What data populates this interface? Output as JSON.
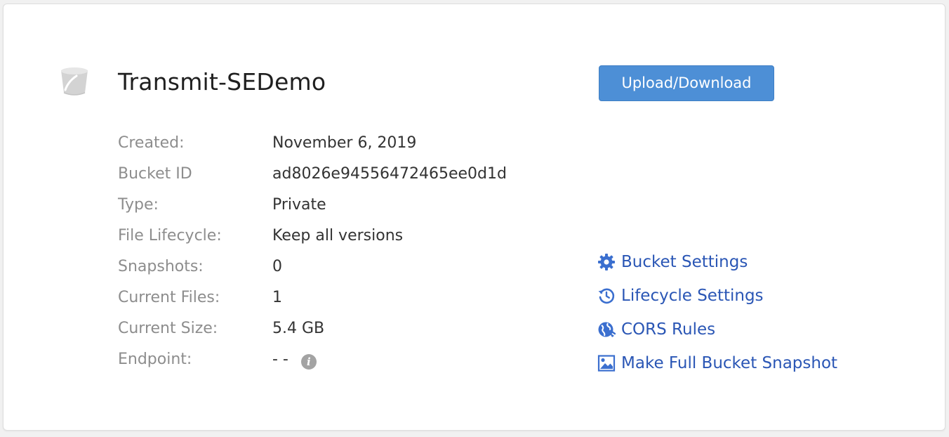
{
  "bucket": {
    "name": "Transmit-SEDemo",
    "icon": "bucket-icon"
  },
  "upload_button": {
    "label": "Upload/Download"
  },
  "details": [
    {
      "label": "Created:",
      "value": "November 6, 2019"
    },
    {
      "label": "Bucket ID",
      "value": "ad8026e94556472465ee0d1d"
    },
    {
      "label": "Type:",
      "value": "Private"
    },
    {
      "label": "File Lifecycle:",
      "value": "Keep all versions"
    },
    {
      "label": "Snapshots:",
      "value": "0"
    },
    {
      "label": "Current Files:",
      "value": "1"
    },
    {
      "label": "Current Size:",
      "value": "5.4 GB"
    },
    {
      "label": "Endpoint:",
      "value": "- -"
    }
  ],
  "actions": [
    {
      "label": "Bucket Settings",
      "icon": "gear-icon"
    },
    {
      "label": "Lifecycle Settings",
      "icon": "history-icon"
    },
    {
      "label": "CORS Rules",
      "icon": "globe-icon"
    },
    {
      "label": "Make Full Bucket Snapshot",
      "icon": "image-icon"
    }
  ],
  "info_icon": {
    "glyph": "i"
  },
  "colors": {
    "accent_button": "#4d8fd6",
    "link": "#2a56b5",
    "label": "#8d8d8d",
    "value": "#333333"
  }
}
